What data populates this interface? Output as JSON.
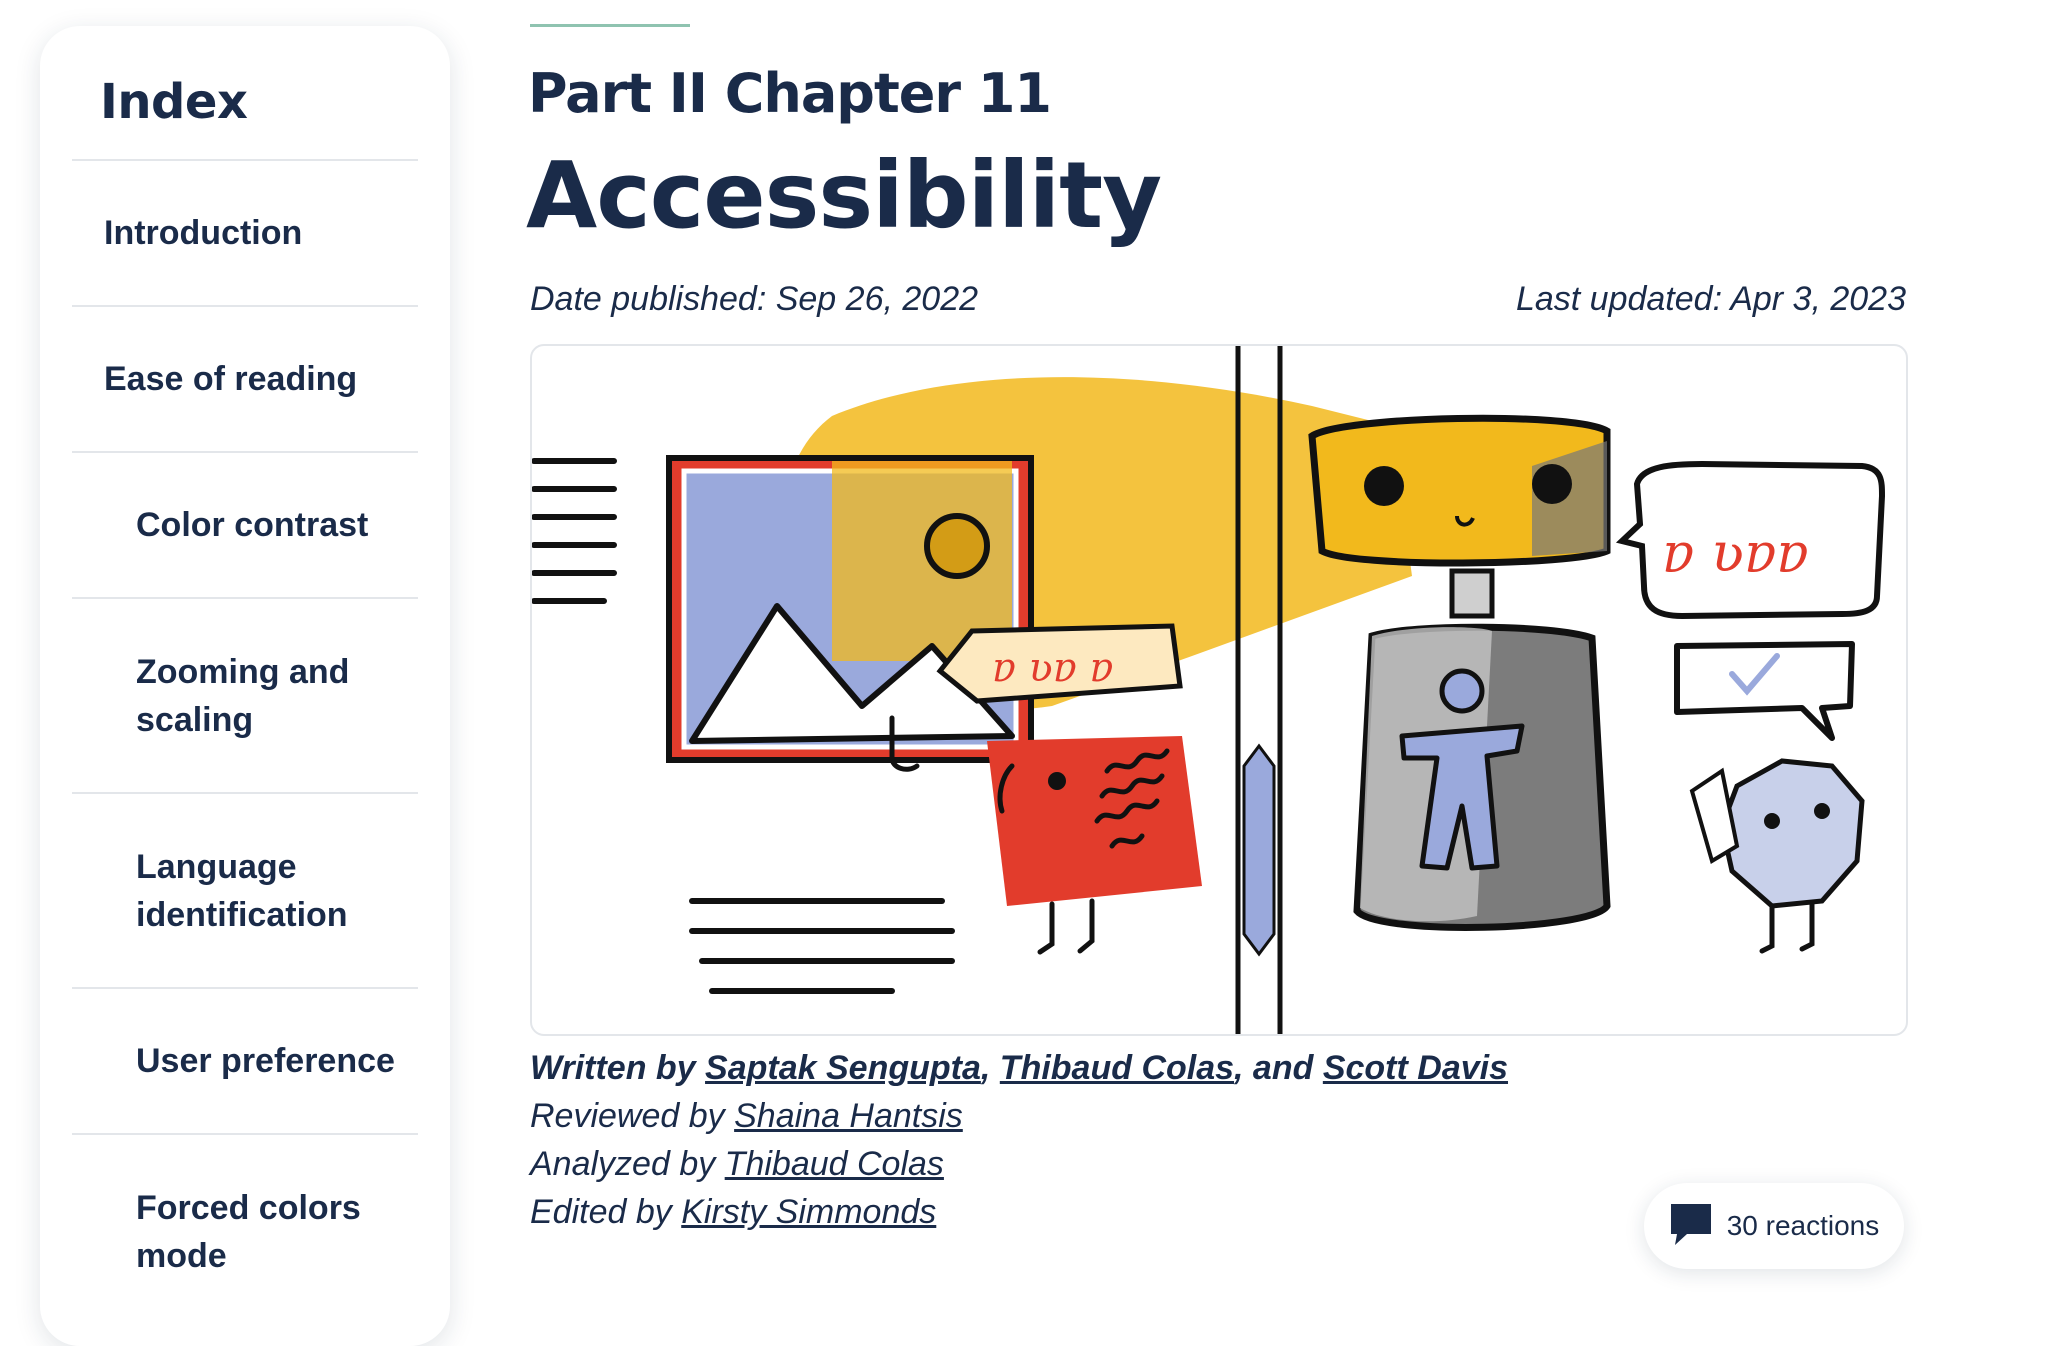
{
  "sidebar": {
    "title": "Index",
    "items": [
      {
        "label": "Introduction"
      },
      {
        "label": "Ease of reading"
      },
      {
        "label": "Color contrast"
      },
      {
        "label": "Zooming and scaling"
      },
      {
        "label": "Language identification"
      },
      {
        "label": "User preference"
      },
      {
        "label": "Forced colors mode"
      }
    ]
  },
  "header": {
    "chapter": "Part II Chapter 11",
    "title": "Accessibility",
    "date_published": "Date published: Sep 26, 2022",
    "last_updated": "Last updated: Apr 3, 2023"
  },
  "hero": {
    "tag_text": "ɐ ʋɐ ɐ",
    "bubble_text": "ɐ ʋɐɐ"
  },
  "credits": {
    "written_prefix": "Written by ",
    "authors": [
      "Saptak Sengupta",
      "Thibaud Colas",
      "Scott Davis"
    ],
    "sep1": ", ",
    "sep2": ", and ",
    "reviewed_prefix": "Reviewed by ",
    "reviewer": "Shaina Hantsis",
    "analyzed_prefix": "Analyzed by ",
    "analyst": "Thibaud Colas",
    "edited_prefix": "Edited by ",
    "editor": "Kirsty Simmonds"
  },
  "reactions": {
    "label": "30 reactions",
    "icon": "comment-icon"
  },
  "colors": {
    "ink": "#1a2b49",
    "accent_rule": "#8fc3b0",
    "illustration_yellow": "#f2b91c",
    "illustration_red": "#e23c2c",
    "illustration_blue": "#9aa9dc"
  }
}
